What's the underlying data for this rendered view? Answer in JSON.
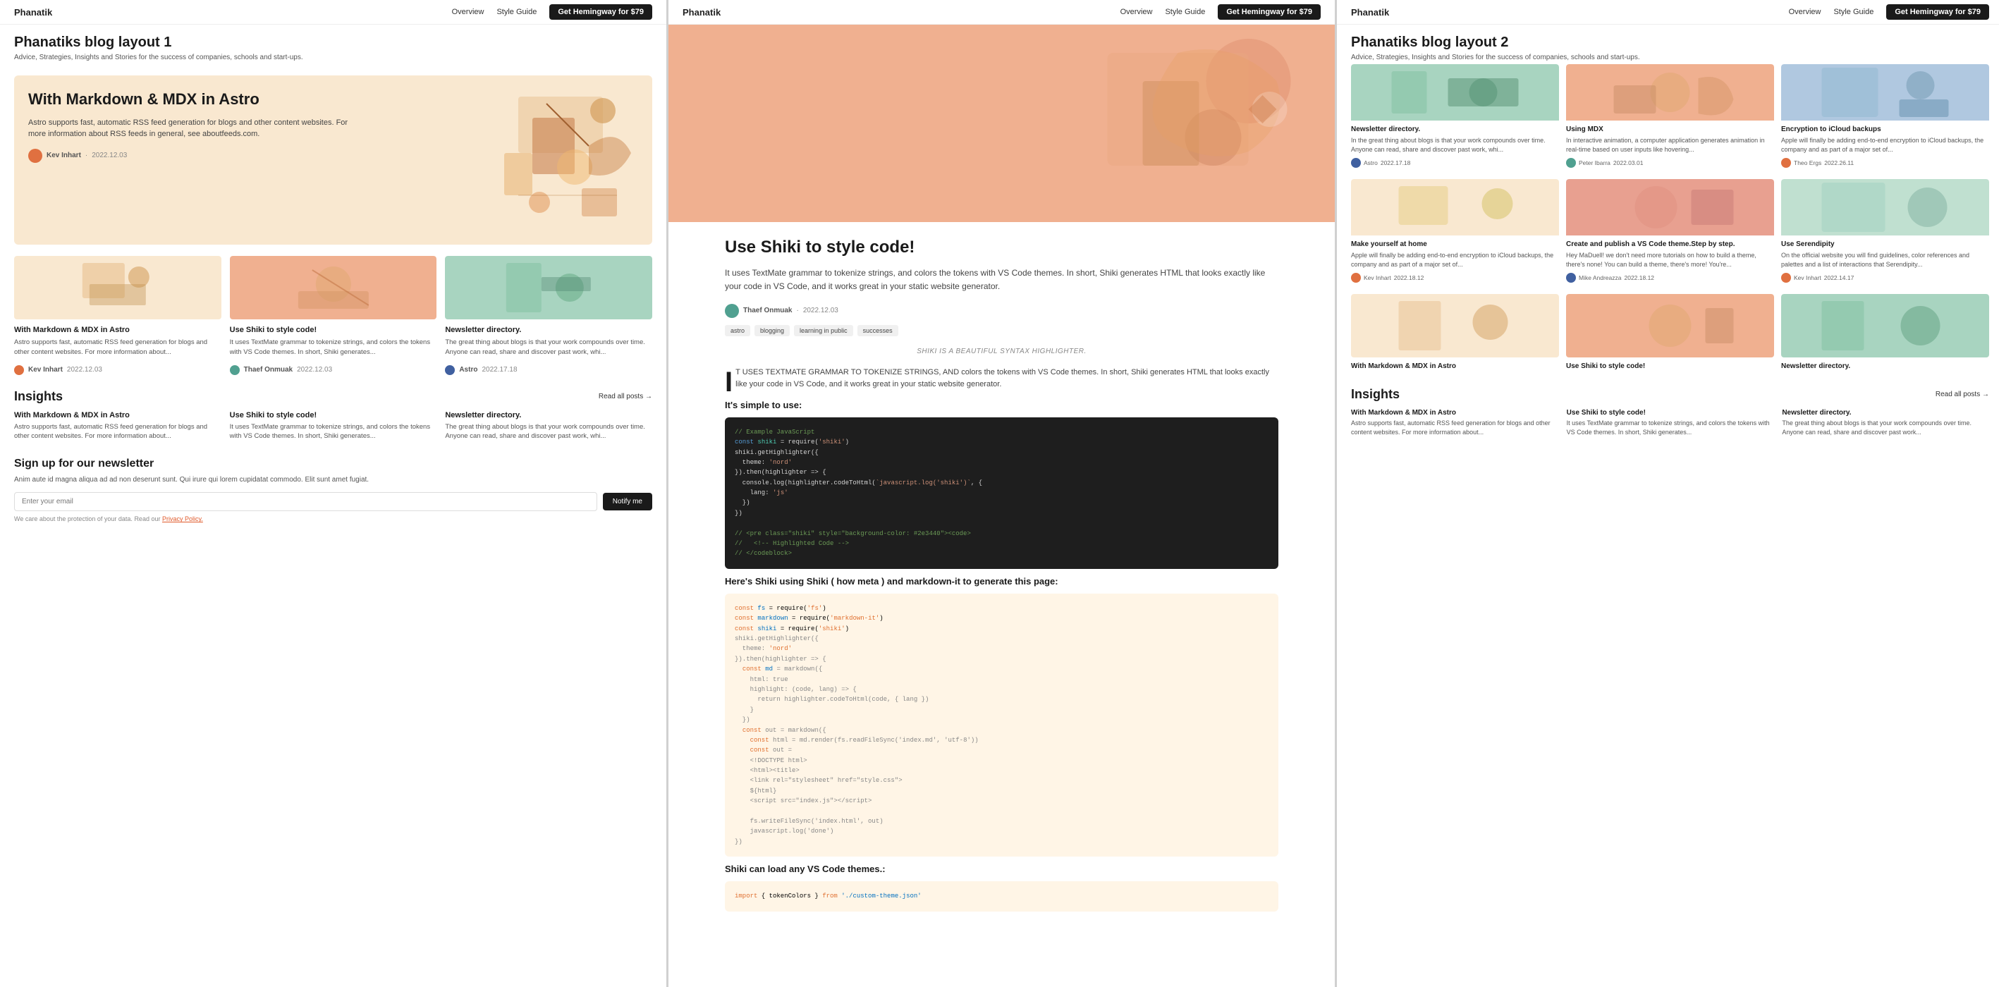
{
  "brand": {
    "name_part1": "Phanat",
    "name_part2": "ik",
    "logo_text": "Phanatik"
  },
  "nav": {
    "overview": "Overview",
    "style_guide": "Style Guide",
    "cta": "Get Hemingway for $79"
  },
  "panel1": {
    "page_title": "Phanatiks blog layout 1",
    "page_subtitle": "Advice, Strategies, Insights and Stories for the success of companies, schools and start-ups.",
    "hero": {
      "title": "With Markdown & MDX in Astro",
      "description": "Astro supports fast, automatic RSS feed generation for blogs and other content websites. For more information about RSS feeds in general, see aboutfeeds.com.",
      "author": "Kev Inhart",
      "date": "2022.12.03"
    },
    "cards": [
      {
        "title": "With Markdown & MDX in Astro",
        "desc": "Astro supports fast, automatic RSS feed generation for blogs and other content websites. For more information about...",
        "author": "Kev Inhart",
        "date": "2022.12.03"
      },
      {
        "title": "Use Shiki to style code!",
        "desc": "It uses TextMate grammar to tokenize strings, and colors the tokens with VS Code themes. In short, Shiki generates...",
        "author": "Thaef Onmuak",
        "date": "2022.12.03"
      },
      {
        "title": "Newsletter directory.",
        "desc": "The great thing about blogs is that your work compounds over time. Anyone can read, share and discover past work, whi...",
        "author": "Astro",
        "date": "2022.17.18"
      }
    ],
    "insights_title": "Insights",
    "read_all": "Read all posts →",
    "insights": [
      {
        "title": "With Markdown & MDX in Astro",
        "desc": "Astro supports fast, automatic RSS feed generation for blogs and other content websites. For more information about..."
      },
      {
        "title": "Use Shiki to style code!",
        "desc": "It uses TextMate grammar to tokenize strings, and colors the tokens with VS Code themes. In short, Shiki generates..."
      },
      {
        "title": "Newsletter directory.",
        "desc": "The great thing about blogs is that your work compounds over time. Anyone can read, share and discover past work, whi..."
      }
    ],
    "newsletter": {
      "title": "Sign up for our newsletter",
      "desc": "Anim aute id magna aliqua ad ad non deserunt sunt. Qui irure qui lorem cupidatat commodo. Elit sunt amet fugiat.",
      "placeholder": "Enter your email",
      "button": "Notify me",
      "note": "We care about the protection of your data. Read our ",
      "policy_link": "Privacy Policy."
    }
  },
  "panel2": {
    "article": {
      "title": "Use Shiki to style code!",
      "description": "It uses TextMate grammar to tokenize strings, and colors the tokens with VS Code themes. In short, Shiki generates HTML that looks exactly like your code in VS Code, and it works great in your static website generator.",
      "author": "Thaef Onmuak",
      "date": "2022.12.03",
      "tags": [
        "astro",
        "blogging",
        "learning in public",
        "successes"
      ],
      "shiki_label": "SHIKI IS A BEAUTIFUL SYNTAX HIGHLIGHTER.",
      "dropcap_text": "IT USES TEXTMATE GRAMMAR TO TOKENIZE STRINGS, AND colors the tokens with VS Code themes. In short, Shiki generates HTML that looks exactly like your code in VS Code, and it works great in your static website generator.",
      "simple_label": "It's simple to use:",
      "code_example_comment": "// Example JavaScript",
      "how_to_label": "Here's Shiki using Shiki ( how meta ) and markdown-it to generate this page:",
      "load_themes_label": "Shiki can load any VS Code themes.:"
    }
  },
  "panel3": {
    "page_title": "Phanatiks blog layout 2",
    "page_subtitle": "Advice, Strategies, Insights and Stories for the success of companies, schools and start-ups.",
    "grid_row1": [
      {
        "title": "Newsletter directory.",
        "desc": "In the great thing about blogs is that your work compounds over time. Anyone can read, share and discover past work, whi...",
        "author": "Astro",
        "date": "2022.17.18",
        "bg": "bg-teal"
      },
      {
        "title": "Using MDX",
        "desc": "In interactive animation, a computer application generates animation in real-time based on user inputs like hovering...",
        "author": "Peter Ibarra",
        "date": "2022.03.01",
        "bg": "bg-peach"
      },
      {
        "title": "Encryption to iCloud backups",
        "desc": "Apple will finally be adding end-to-end encryption to iCloud backups, the company and as part of a major set of...",
        "author": "Theo Ergs",
        "date": "2022.26.11",
        "bg": "bg-blue"
      }
    ],
    "grid_row2": [
      {
        "title": "Make yourself at home",
        "desc": "Apple will finally be adding end-to-end encryption to iCloud backups, the company and as part of a major set of...",
        "author": "Kev Inhart",
        "date": "2022.18.12",
        "bg": "bg-yellow"
      },
      {
        "title": "Create and publish a VS Code theme.Step by step.",
        "desc": "Hey MaDuell! we don't need more tutorials on how to build a theme, there's none! You can build a theme, there's more! You're...",
        "author": "Mike Andreazza",
        "date": "2022.18.12",
        "bg": "bg-salmon"
      },
      {
        "title": "Use Serendipity",
        "desc": "On the official website you will find guidelines, color references and palettes and a list of interactions that Serendipity...",
        "author": "Kev Inhart",
        "date": "2022.14.17",
        "bg": "bg-mint"
      }
    ],
    "grid_row3": [
      {
        "title": "With Markdown & MDX in Astro",
        "desc": "",
        "bg": "bg-yellow"
      },
      {
        "title": "Use Shiki to style code!",
        "desc": "",
        "bg": "bg-peach"
      },
      {
        "title": "Newsletter directory.",
        "desc": "",
        "bg": "bg-teal"
      }
    ],
    "insights_title": "Insights",
    "read_all": "Read all posts →",
    "insights": [
      {
        "title": "With Markdown & MDX in Astro",
        "desc": "Astro supports fast, automatic RSS feed generation for blogs and other content websites. For more information about..."
      },
      {
        "title": "Use Shiki to style code!",
        "desc": "It uses TextMate grammar to tokenize strings, and colors the tokens with VS Code themes. In short, Shiki generates..."
      },
      {
        "title": "Newsletter directory.",
        "desc": "The great thing about blogs is that your work compounds over time. Anyone can read, share and discover past work..."
      }
    ]
  }
}
